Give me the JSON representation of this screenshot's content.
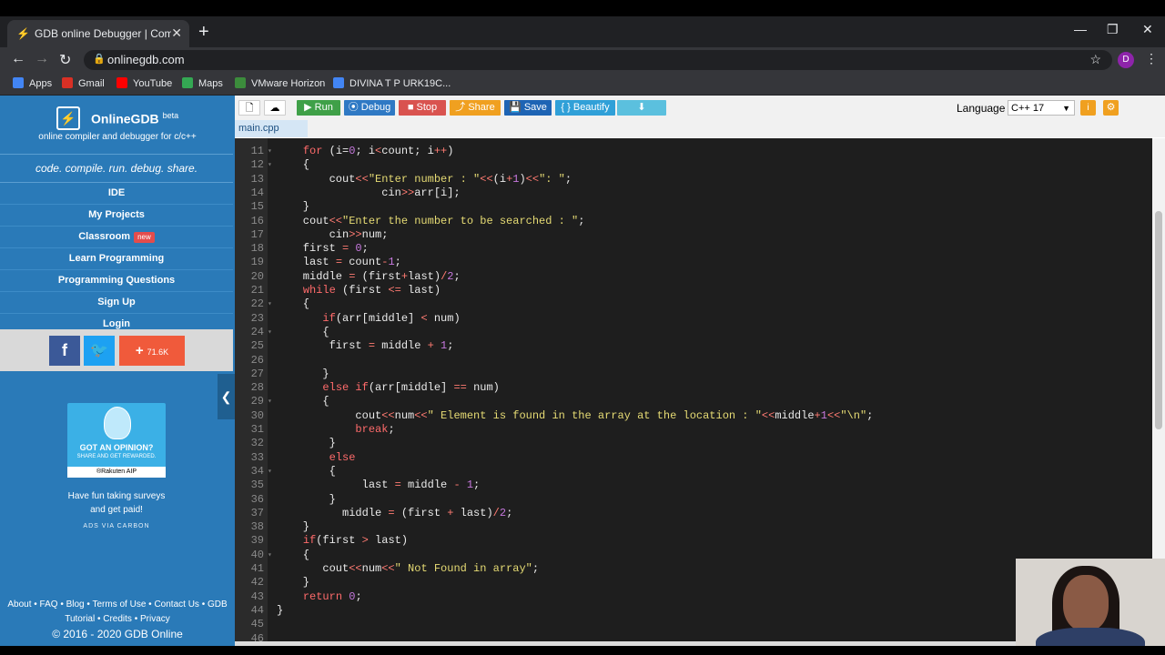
{
  "browser": {
    "tab_title": "GDB online Debugger | Compiler",
    "new_tab": "+",
    "url": "onlinegdb.com",
    "profile_initial": "D",
    "window_controls": [
      "—",
      "❐",
      "✕"
    ],
    "bookmarks": [
      {
        "label": "Apps",
        "icon": "apps-grid-icon",
        "color": "#4285f4"
      },
      {
        "label": "Gmail",
        "icon": "gmail-icon",
        "color": "#d93025"
      },
      {
        "label": "YouTube",
        "icon": "youtube-icon",
        "color": "#ff0000"
      },
      {
        "label": "Maps",
        "icon": "maps-icon",
        "color": "#34a853"
      },
      {
        "label": "VMware Horizon",
        "icon": "vmware-icon",
        "color": "#3c8c3c"
      },
      {
        "label": "DIVINA T P URK19C...",
        "icon": "docs-icon",
        "color": "#4285f4"
      }
    ]
  },
  "sidebar": {
    "brand": "OnlineGDB",
    "beta": "beta",
    "tagline": "online compiler and debugger for c/c++",
    "motto": "code. compile. run. debug. share.",
    "menu": [
      {
        "label": "IDE",
        "badge": ""
      },
      {
        "label": "My Projects",
        "badge": ""
      },
      {
        "label": "Classroom",
        "badge": "new"
      },
      {
        "label": "Learn Programming",
        "badge": ""
      },
      {
        "label": "Programming Questions",
        "badge": ""
      },
      {
        "label": "Sign Up",
        "badge": ""
      },
      {
        "label": "Login",
        "badge": ""
      }
    ],
    "social": {
      "facebook": "f",
      "twitter": "🐦",
      "share_plus": "+",
      "share_count": "71.6K"
    },
    "collapse": "❮",
    "ad": {
      "headline": "GOT AN OPINION?",
      "sub": "SHARE AND GET REWARDED.",
      "brand": "®Rakuten AIP",
      "text_line1": "Have fun taking surveys",
      "text_line2": "and get paid!",
      "via": "ADS VIA CARBON"
    },
    "footer": {
      "links_line1": "About • FAQ • Blog • Terms of Use • Contact Us • GDB",
      "links_line2": "Tutorial • Credits • Privacy",
      "copyright": "© 2016 - 2020 GDB Online"
    }
  },
  "toolbar": {
    "buttons": [
      {
        "label": "",
        "icon": "new-file-icon",
        "color": "#ffffff"
      },
      {
        "label": "",
        "icon": "upload-icon",
        "color": "#ffffff"
      },
      {
        "label": "▶ Run",
        "icon": "run-icon",
        "color": "#3fa048"
      },
      {
        "label": "⦿ Debug",
        "icon": "debug-icon",
        "color": "#2f79c4"
      },
      {
        "label": "■ Stop",
        "icon": "stop-icon",
        "color": "#d9534f"
      },
      {
        "label": "⤴ Share",
        "icon": "share-icon",
        "color": "#f0a020"
      },
      {
        "label": "💾 Save",
        "icon": "save-icon",
        "color": "#1e64b4"
      },
      {
        "label": "{ } Beautify",
        "icon": "beautify-icon",
        "color": "#30a0d8"
      },
      {
        "label": "⬇",
        "icon": "download-icon",
        "color": "#5bc0de"
      }
    ],
    "language_label": "Language",
    "language_value": "C++ 17"
  },
  "file_tab": "main.cpp",
  "code_lines": [
    {
      "n": "11",
      "fold": "▾",
      "html": "    <span class=\"k\">for</span> (i=<span class=\"n\">0</span>; i<span class=\"o\">&lt;</span>count; i<span class=\"o\">++</span>)"
    },
    {
      "n": "12",
      "fold": "▾",
      "html": "    {"
    },
    {
      "n": "13",
      "fold": "",
      "html": "        cout<span class=\"o\">&lt;&lt;</span><span class=\"s\">\"Enter number : \"</span><span class=\"o\">&lt;&lt;</span>(i<span class=\"o\">+</span><span class=\"n\">1</span>)<span class=\"o\">&lt;&lt;</span><span class=\"s\">\": \"</span>;"
    },
    {
      "n": "14",
      "fold": "",
      "html": "                cin<span class=\"o\">&gt;&gt;</span>arr[i];"
    },
    {
      "n": "15",
      "fold": "",
      "html": "    }"
    },
    {
      "n": "16",
      "fold": "",
      "html": "    cout<span class=\"o\">&lt;&lt;</span><span class=\"s\">\"Enter the number to be searched : \"</span>;"
    },
    {
      "n": "17",
      "fold": "",
      "html": "        cin<span class=\"o\">&gt;&gt;</span>num;"
    },
    {
      "n": "18",
      "fold": "",
      "html": "    first <span class=\"o\">=</span> <span class=\"n\">0</span>;"
    },
    {
      "n": "19",
      "fold": "",
      "html": "    last <span class=\"o\">=</span> count<span class=\"o\">-</span><span class=\"n\">1</span>;"
    },
    {
      "n": "20",
      "fold": "",
      "html": "    middle <span class=\"o\">=</span> (first<span class=\"o\">+</span>last)<span class=\"o\">/</span><span class=\"n\">2</span>;"
    },
    {
      "n": "21",
      "fold": "",
      "html": "    <span class=\"k\">while</span> (first <span class=\"o\">&lt;=</span> last)"
    },
    {
      "n": "22",
      "fold": "▾",
      "html": "    {"
    },
    {
      "n": "23",
      "fold": "",
      "html": "       <span class=\"k\">if</span>(arr[middle] <span class=\"o\">&lt;</span> num)"
    },
    {
      "n": "24",
      "fold": "▾",
      "html": "       {"
    },
    {
      "n": "25",
      "fold": "",
      "html": "        first <span class=\"o\">=</span> middle <span class=\"o\">+</span> <span class=\"n\">1</span>;"
    },
    {
      "n": "26",
      "fold": "",
      "html": ""
    },
    {
      "n": "27",
      "fold": "",
      "html": "       }"
    },
    {
      "n": "28",
      "fold": "",
      "html": "       <span class=\"k\">else if</span>(arr[middle] <span class=\"o\">==</span> num)"
    },
    {
      "n": "29",
      "fold": "▾",
      "html": "       {"
    },
    {
      "n": "30",
      "fold": "",
      "html": "            cout<span class=\"o\">&lt;&lt;</span>num<span class=\"o\">&lt;&lt;</span><span class=\"s\">\" Element is found in the array at the location : \"</span><span class=\"o\">&lt;&lt;</span>middle<span class=\"o\">+</span><span class=\"n\">1</span><span class=\"o\">&lt;&lt;</span><span class=\"s\">\"\\n\"</span>;"
    },
    {
      "n": "31",
      "fold": "",
      "html": "            <span class=\"k\">break</span>;"
    },
    {
      "n": "32",
      "fold": "",
      "html": "        }"
    },
    {
      "n": "33",
      "fold": "",
      "html": "        <span class=\"k\">else</span>"
    },
    {
      "n": "34",
      "fold": "▾",
      "html": "        {"
    },
    {
      "n": "35",
      "fold": "",
      "html": "             last <span class=\"o\">=</span> middle <span class=\"o\">-</span> <span class=\"n\">1</span>;"
    },
    {
      "n": "36",
      "fold": "",
      "html": "        }"
    },
    {
      "n": "37",
      "fold": "",
      "html": "          middle <span class=\"o\">=</span> (first <span class=\"o\">+</span> last)<span class=\"o\">/</span><span class=\"n\">2</span>;"
    },
    {
      "n": "38",
      "fold": "",
      "html": "    }"
    },
    {
      "n": "39",
      "fold": "",
      "html": "    <span class=\"k\">if</span>(first <span class=\"o\">&gt;</span> last)"
    },
    {
      "n": "40",
      "fold": "▾",
      "html": "    {"
    },
    {
      "n": "41",
      "fold": "",
      "html": "       cout<span class=\"o\">&lt;&lt;</span>num<span class=\"o\">&lt;&lt;</span><span class=\"s\">\" Not Found in array\"</span>;"
    },
    {
      "n": "42",
      "fold": "",
      "html": "    }"
    },
    {
      "n": "43",
      "fold": "",
      "html": "    <span class=\"k\">return</span> <span class=\"n\">0</span>;"
    },
    {
      "n": "44",
      "fold": "",
      "html": "}"
    },
    {
      "n": "45",
      "fold": "",
      "html": ""
    },
    {
      "n": "46",
      "fold": "",
      "html": ""
    }
  ]
}
